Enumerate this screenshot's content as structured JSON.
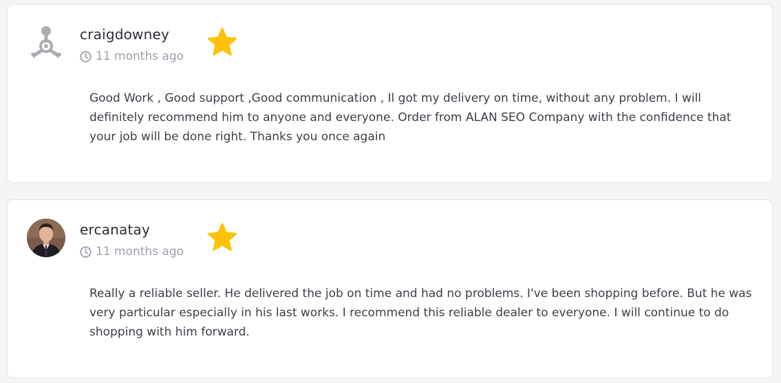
{
  "reviews": [
    {
      "username": "craigdowney",
      "time": "11 months ago",
      "avatar_icon": "default-user-avatar-icon",
      "rating_icon": "star-icon",
      "rating_color": "#FFC107",
      "text": "Good Work , Good support ,Good communication , Il got my delivery on time, without any problem. I will definitely recommend him to anyone and everyone. Order from ALAN SEO Company with the confidence that your job will be done right. Thanks you once again"
    },
    {
      "username": "ercanatay",
      "time": "11 months ago",
      "avatar_icon": "user-photo-avatar",
      "rating_icon": "star-icon",
      "rating_color": "#FFC107",
      "text": "Really a reliable seller. He delivered the job on time and had no problems. I've been shopping before. But he was very particular especially in his last works. I recommend this reliable dealer to everyone. I will continue to do shopping with him forward."
    }
  ]
}
